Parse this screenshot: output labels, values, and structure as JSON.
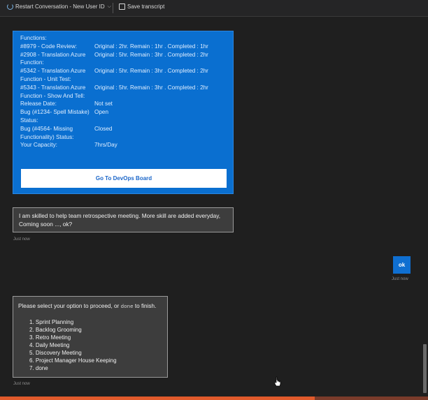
{
  "toolbar": {
    "restart_label": "Restart Conversation - New User ID",
    "save_label": "Save transcript"
  },
  "card": {
    "rows": [
      {
        "label": "Functions:",
        "value": ""
      },
      {
        "label": "#8979 - Code Review:",
        "value": "Original : 2hr. Remain : 1hr . Completed : 1hr"
      },
      {
        "label": "#2908 - Translation Azure Function:",
        "value": "Original : 5hr. Remain : 3hr . Completed : 2hr"
      },
      {
        "label": "#5342 - Translation Azure Function - Unit Test:",
        "value": "Original : 5hr. Remain : 3hr . Completed : 2hr"
      },
      {
        "label": "#5343 - Translation Azure Function - Show And Tell:",
        "value": "Original : 5hr. Remain : 3hr . Completed : 2hr"
      },
      {
        "label": "Release Date:",
        "value": "Not set"
      },
      {
        "label": "Bug (#1234- Spell Mistake) Status:",
        "value": "Open"
      },
      {
        "label": "Bug (#4564- Missing Functionality) Status:",
        "value": "Closed"
      },
      {
        "label": "Your Capacity:",
        "value": "7hrs/Day"
      }
    ],
    "button_label": "Go To DevOps Board"
  },
  "bot_message": {
    "text": "I am skilled to help team retrospective meeting. More skill are added everyday, Coming soon ..., ok?",
    "timestamp": "Just now"
  },
  "user_message": {
    "text": "ok",
    "timestamp": "Just now"
  },
  "options_message": {
    "prompt_before": "Please select your option to proceed, or ",
    "done_word": "done",
    "prompt_after": " to finish.",
    "options": [
      "1. Sprint Planning",
      "2. Backlog Grooming",
      "3. Retro Meeting",
      "4. Daily Meeting",
      "5. Discovery Meeting",
      "6. Project Manager House Keeping",
      "7. done"
    ],
    "timestamp": "Just now"
  },
  "colors": {
    "card_blue": "#0a6fd0",
    "user_bubble": "#0f6fd1",
    "accent_bar": "#e05a2b"
  },
  "icons": [
    "restart-icon",
    "chevron-down-icon",
    "save-icon",
    "mouse-cursor-icon"
  ]
}
